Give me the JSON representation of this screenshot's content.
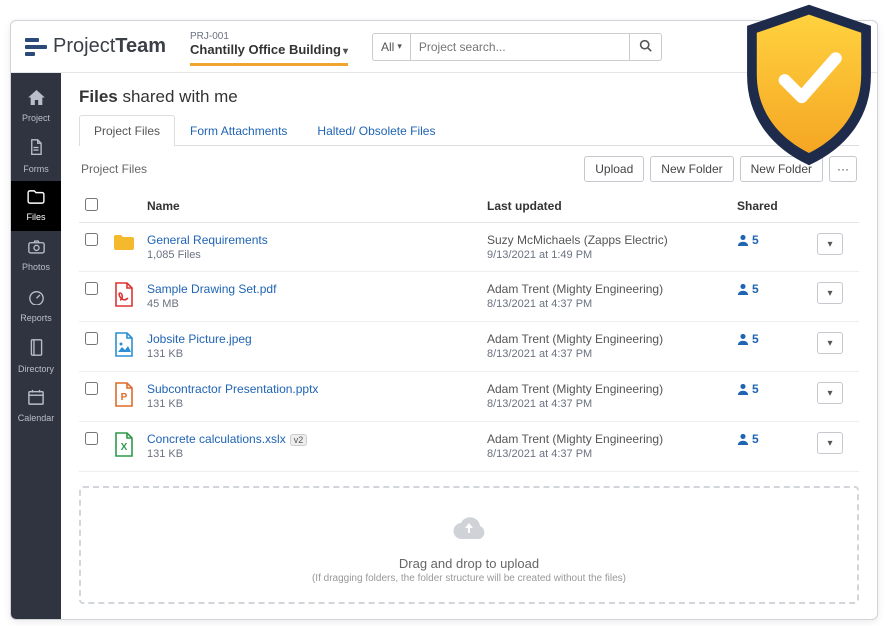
{
  "logo": {
    "brand1": "Project",
    "brand2": "Team"
  },
  "project": {
    "code": "PRJ-001",
    "name": "Chantilly Office Building"
  },
  "search": {
    "scope": "All",
    "placeholder": "Project search..."
  },
  "sidebar": [
    {
      "label": "Project",
      "icon": "home"
    },
    {
      "label": "Forms",
      "icon": "doc"
    },
    {
      "label": "Files",
      "icon": "folder",
      "active": true
    },
    {
      "label": "Photos",
      "icon": "camera"
    },
    {
      "label": "Reports",
      "icon": "gauge"
    },
    {
      "label": "Directory",
      "icon": "book"
    },
    {
      "label": "Calendar",
      "icon": "calendar"
    }
  ],
  "page": {
    "title_bold": "Files",
    "title_rest": " shared with me"
  },
  "tabs": [
    {
      "label": "Project Files",
      "active": true
    },
    {
      "label": "Form Attachments"
    },
    {
      "label": "Halted/ Obsolete Files"
    }
  ],
  "panel": {
    "label": "Project Files"
  },
  "actions": {
    "upload": "Upload",
    "new_folder1": "New Folder",
    "new_folder2": "New Folder",
    "more": "···"
  },
  "columns": {
    "name": "Name",
    "updated": "Last updated",
    "shared": "Shared"
  },
  "rows": [
    {
      "icon": "folder",
      "name": "General Requirements",
      "sub": "1,085 Files",
      "updated_by": "Suzy McMichaels (Zapps Electric)",
      "updated_at": "9/13/2021 at 1:49 PM",
      "shared": "5"
    },
    {
      "icon": "pdf",
      "name": "Sample Drawing Set.pdf",
      "sub": "45 MB",
      "updated_by": "Adam Trent (Mighty Engineering)",
      "updated_at": "8/13/2021 at 4:37 PM",
      "shared": "5"
    },
    {
      "icon": "image",
      "name": "Jobsite Picture.jpeg",
      "sub": "131 KB",
      "updated_by": "Adam Trent (Mighty Engineering)",
      "updated_at": "8/13/2021 at 4:37 PM",
      "shared": "5"
    },
    {
      "icon": "ppt",
      "name": "Subcontractor Presentation.pptx",
      "sub": "131 KB",
      "updated_by": "Adam Trent (Mighty Engineering)",
      "updated_at": "8/13/2021 at 4:37 PM",
      "shared": "5"
    },
    {
      "icon": "xls",
      "name": "Concrete calculations.xslx",
      "badge": "v2",
      "sub": "131 KB",
      "updated_by": "Adam Trent (Mighty Engineering)",
      "updated_at": "8/13/2021 at 4:37 PM",
      "shared": "5"
    }
  ],
  "dropzone": {
    "main": "Drag and drop to upload",
    "sub": "(If dragging folders, the folder structure will be created without the files)"
  }
}
